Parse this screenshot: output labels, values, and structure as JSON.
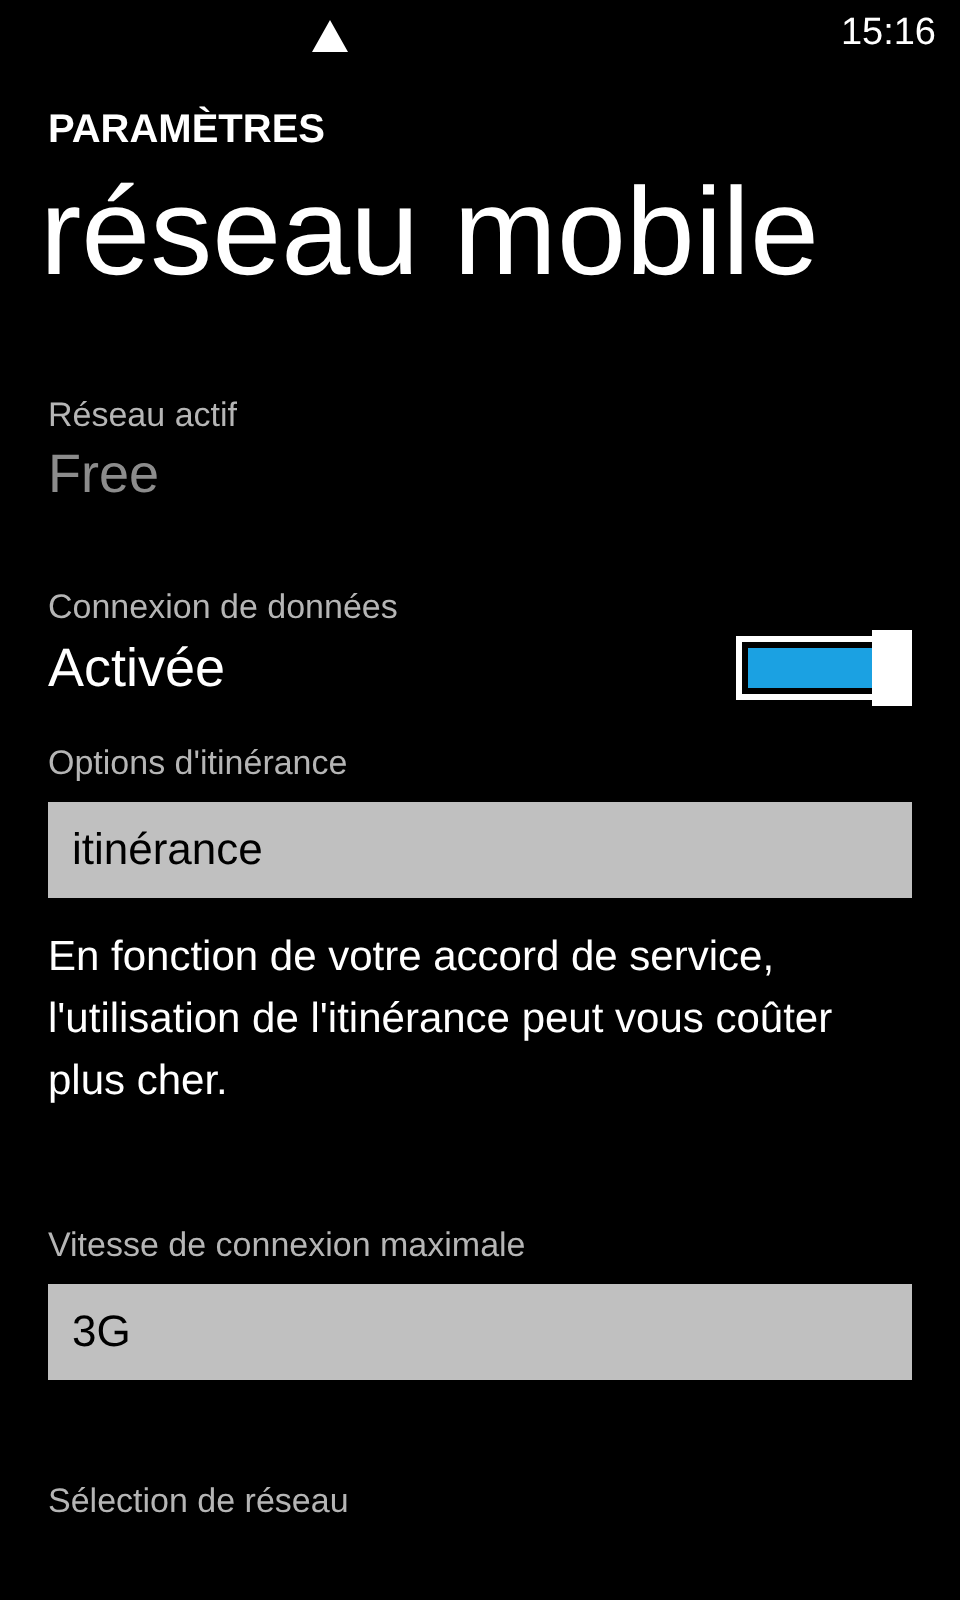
{
  "status_bar": {
    "time": "15:16"
  },
  "header": {
    "app": "PARAMÈTRES",
    "title": "réseau mobile"
  },
  "settings": [
    {
      "kind": "value",
      "label": "Réseau actif",
      "value": "Free",
      "disabled": true
    },
    {
      "kind": "toggle",
      "label": "Connexion de données",
      "value": "Activée",
      "on": true
    },
    {
      "kind": "dropdown",
      "label": "Options d'itinérance",
      "value": "itinérance"
    },
    {
      "kind": "note",
      "text": "En fonction de votre accord de service, l'utilisation de l'itinérance peut vous coûter plus cher."
    },
    {
      "kind": "dropdown",
      "label": "Vitesse de connexion maximale",
      "value": "3G"
    },
    {
      "kind": "heading",
      "label": "Sélection de réseau"
    }
  ]
}
